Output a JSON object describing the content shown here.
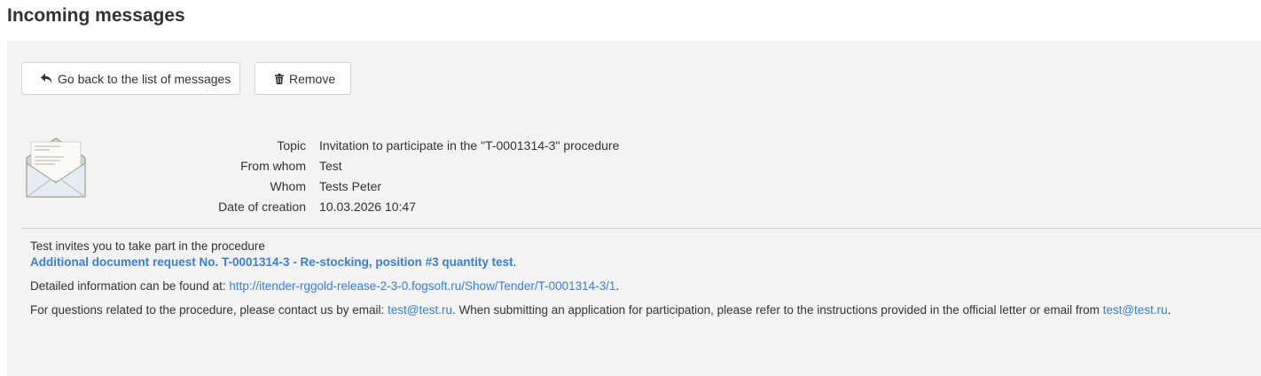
{
  "page": {
    "title": "Incoming messages"
  },
  "toolbar": {
    "back_label": "Go back to the list of messages",
    "back_icon": "reply-arrow-icon",
    "remove_label": "Remove",
    "remove_icon": "trash-icon"
  },
  "message": {
    "icon": "open-envelope-icon",
    "fields": [
      {
        "label": "Topic",
        "value": "Invitation to participate in the \"T-0001314-3\" procedure"
      },
      {
        "label": "From whom",
        "value": "Test"
      },
      {
        "label": "Whom",
        "value": "Tests Peter"
      },
      {
        "label": "Date of creation",
        "value": "10.03.2026 10:47"
      }
    ],
    "body": {
      "line1": "Test invites you to take part in the procedure",
      "procedure_link": "Additional document request No. T-0001314-3 - Re-stocking, position #3 quantity test",
      "procedure_link_suffix": ".",
      "details_prefix": "Detailed information can be found at: ",
      "details_link": "http://itender-rggold-release-2-3-0.fogsoft.ru/Show/Tender/T-0001314-3/1",
      "details_suffix": ".",
      "contact_prefix": "For questions related to the procedure, please contact us by email: ",
      "contact_email": "test@test.ru",
      "contact_middle": ". When submitting an application for participation, please refer to the instructions provided in the official letter or email from ",
      "contact_email2": "test@test.ru",
      "contact_suffix": "."
    }
  },
  "colors": {
    "link": "#3a7fd5",
    "panel_background": "#f3f3f3",
    "text": "#333333"
  }
}
